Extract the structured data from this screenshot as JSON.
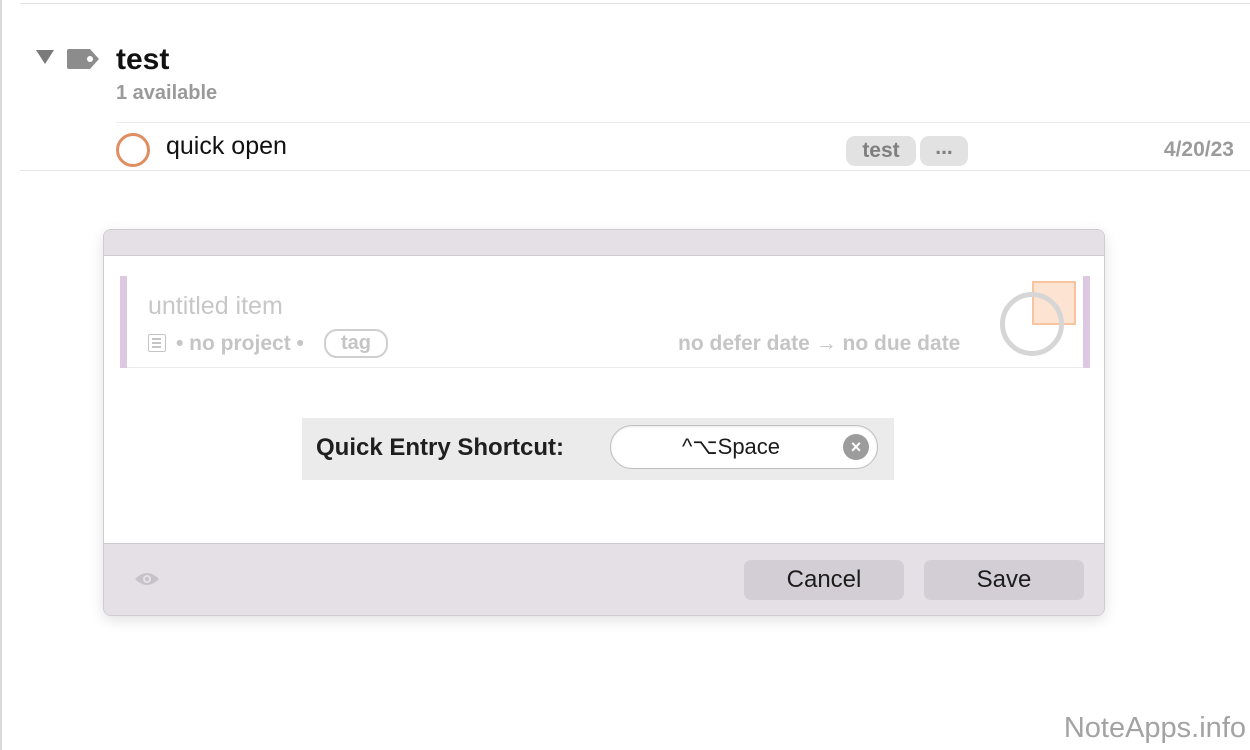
{
  "group": {
    "title": "test",
    "subtitle": "1 available",
    "icon": "tag-icon"
  },
  "task": {
    "title": "quick open",
    "tags": [
      "test",
      "..."
    ],
    "date": "4/20/23",
    "status_color": "#e08e60"
  },
  "dialog": {
    "preview": {
      "title_placeholder": "untitled item",
      "project": "• no project •",
      "tag_placeholder": "tag",
      "dates": "no defer date → no due date"
    },
    "shortcut": {
      "label": "Quick Entry Shortcut:",
      "value": "^⌥Space",
      "clear": "×"
    },
    "buttons": {
      "cancel": "Cancel",
      "save": "Save"
    }
  },
  "watermark": "NoteApps.info"
}
